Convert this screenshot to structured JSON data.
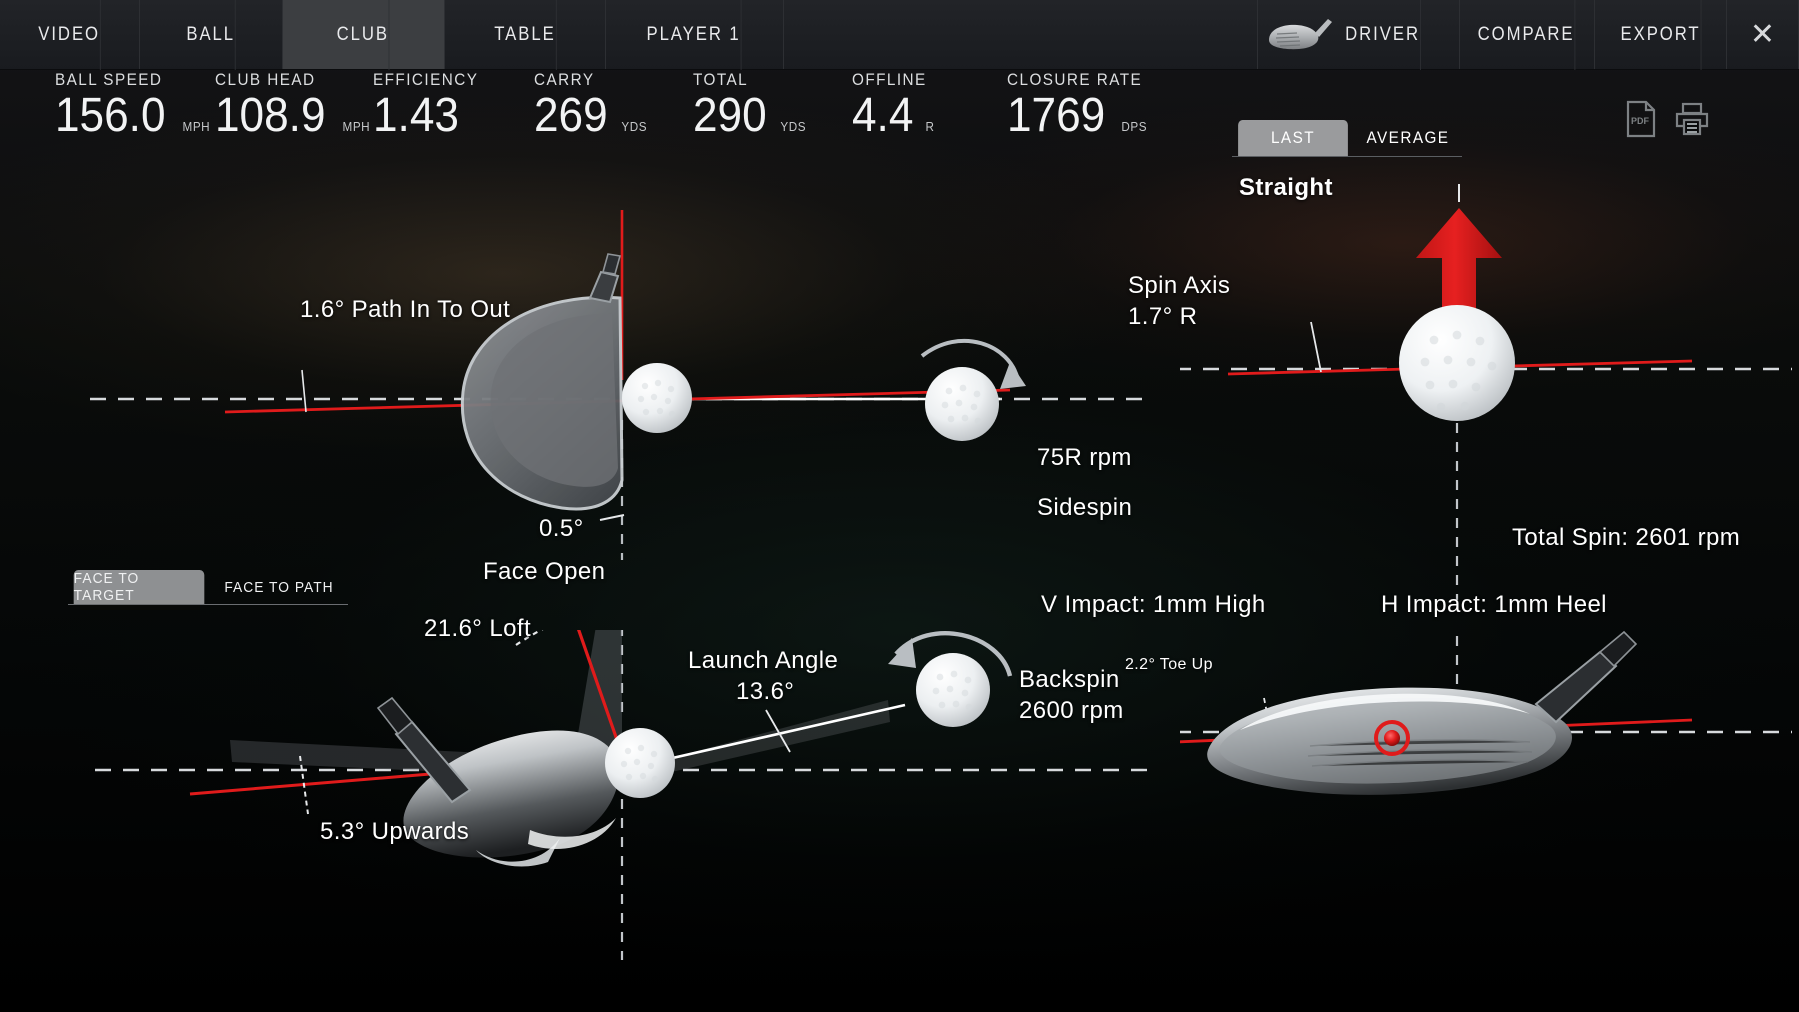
{
  "header": {
    "tabs": [
      {
        "label": "VIDEO",
        "active": false
      },
      {
        "label": "BALL",
        "active": false
      },
      {
        "label": "CLUB",
        "active": true
      },
      {
        "label": "TABLE",
        "active": false
      },
      {
        "label": "PLAYER 1",
        "active": false
      }
    ],
    "club_icon": "driver-icon",
    "club_label": "DRIVER",
    "compare_label": "COMPARE",
    "export_label": "EXPORT",
    "close_label": "✕"
  },
  "stats": [
    {
      "label": "BALL SPEED",
      "value": "156.0",
      "unit": "MPH"
    },
    {
      "label": "CLUB HEAD",
      "value": "108.9",
      "unit": "MPH"
    },
    {
      "label": "EFFICIENCY",
      "value": "1.43",
      "unit": ""
    },
    {
      "label": "CARRY",
      "value": "269",
      "unit": "YDS"
    },
    {
      "label": "TOTAL",
      "value": "290",
      "unit": "YDS"
    },
    {
      "label": "OFFLINE",
      "value": "4.4",
      "unit": "R"
    },
    {
      "label": "CLOSURE RATE",
      "value": "1769",
      "unit": "DPS"
    }
  ],
  "view_toggle": {
    "last_label": "LAST",
    "average_label": "AVERAGE",
    "selected": "LAST"
  },
  "export_icons": [
    {
      "name": "pdf-icon",
      "label": "PDF"
    },
    {
      "name": "print-icon",
      "label": "Print"
    }
  ],
  "face_toggle": {
    "face_to_target_label": "FACE TO TARGET",
    "face_to_path_label": "FACE TO PATH",
    "selected": "FACE TO TARGET"
  },
  "panels": {
    "top_down": {
      "path_label": "1.6° Path In To Out",
      "face_angle": "0.5°",
      "face_state": "Face Open",
      "sidespin_value": "75R rpm",
      "sidespin_label": "Sidespin"
    },
    "side_on": {
      "loft_label": "21.6° Loft",
      "launch_label": "Launch Angle",
      "launch_value": "13.6°",
      "backspin_label": "Backspin",
      "backspin_value": "2600 rpm",
      "attack_label": "5.3° Upwards"
    },
    "spin_axis": {
      "direction_label": "Straight",
      "spin_axis_label": "Spin Axis",
      "spin_axis_value": "1.7° R",
      "total_spin_label": "Total Spin: 2601 rpm"
    },
    "impact": {
      "v_impact_label": "V Impact: 1mm High",
      "h_impact_label": "H Impact: 1mm Heel",
      "lie_label": "2.2° Toe Up"
    }
  },
  "colors": {
    "accent_red": "#e01b1b",
    "header_bg": "#1d1f23",
    "active_tab_bg": "#3c3e41",
    "toggle_active": "#9a9b9d",
    "text": "#ffffff"
  },
  "chart_data": {
    "type": "diagram",
    "title": "Club Data — Driver",
    "metrics": {
      "ball_speed_mph": 156.0,
      "club_head_speed_mph": 108.9,
      "efficiency": 1.43,
      "carry_yds": 269,
      "total_yds": 290,
      "offline_r": 4.4,
      "closure_rate_dps": 1769,
      "club_path_deg": 1.6,
      "club_path_direction": "In To Out",
      "face_angle_deg": 0.5,
      "face_state": "Open",
      "sidespin_rpm": 75,
      "sidespin_direction": "R",
      "loft_deg": 21.6,
      "launch_angle_deg": 13.6,
      "backspin_rpm": 2600,
      "attack_angle_deg": 5.3,
      "attack_direction": "Upwards",
      "spin_axis_deg": 1.7,
      "spin_axis_direction": "R",
      "shot_shape": "Straight",
      "total_spin_rpm": 2601,
      "vertical_impact_mm": 1,
      "vertical_impact_direction": "High",
      "horizontal_impact_mm": 1,
      "horizontal_impact_direction": "Heel",
      "lie_deg": 2.2,
      "lie_direction": "Toe Up"
    }
  }
}
